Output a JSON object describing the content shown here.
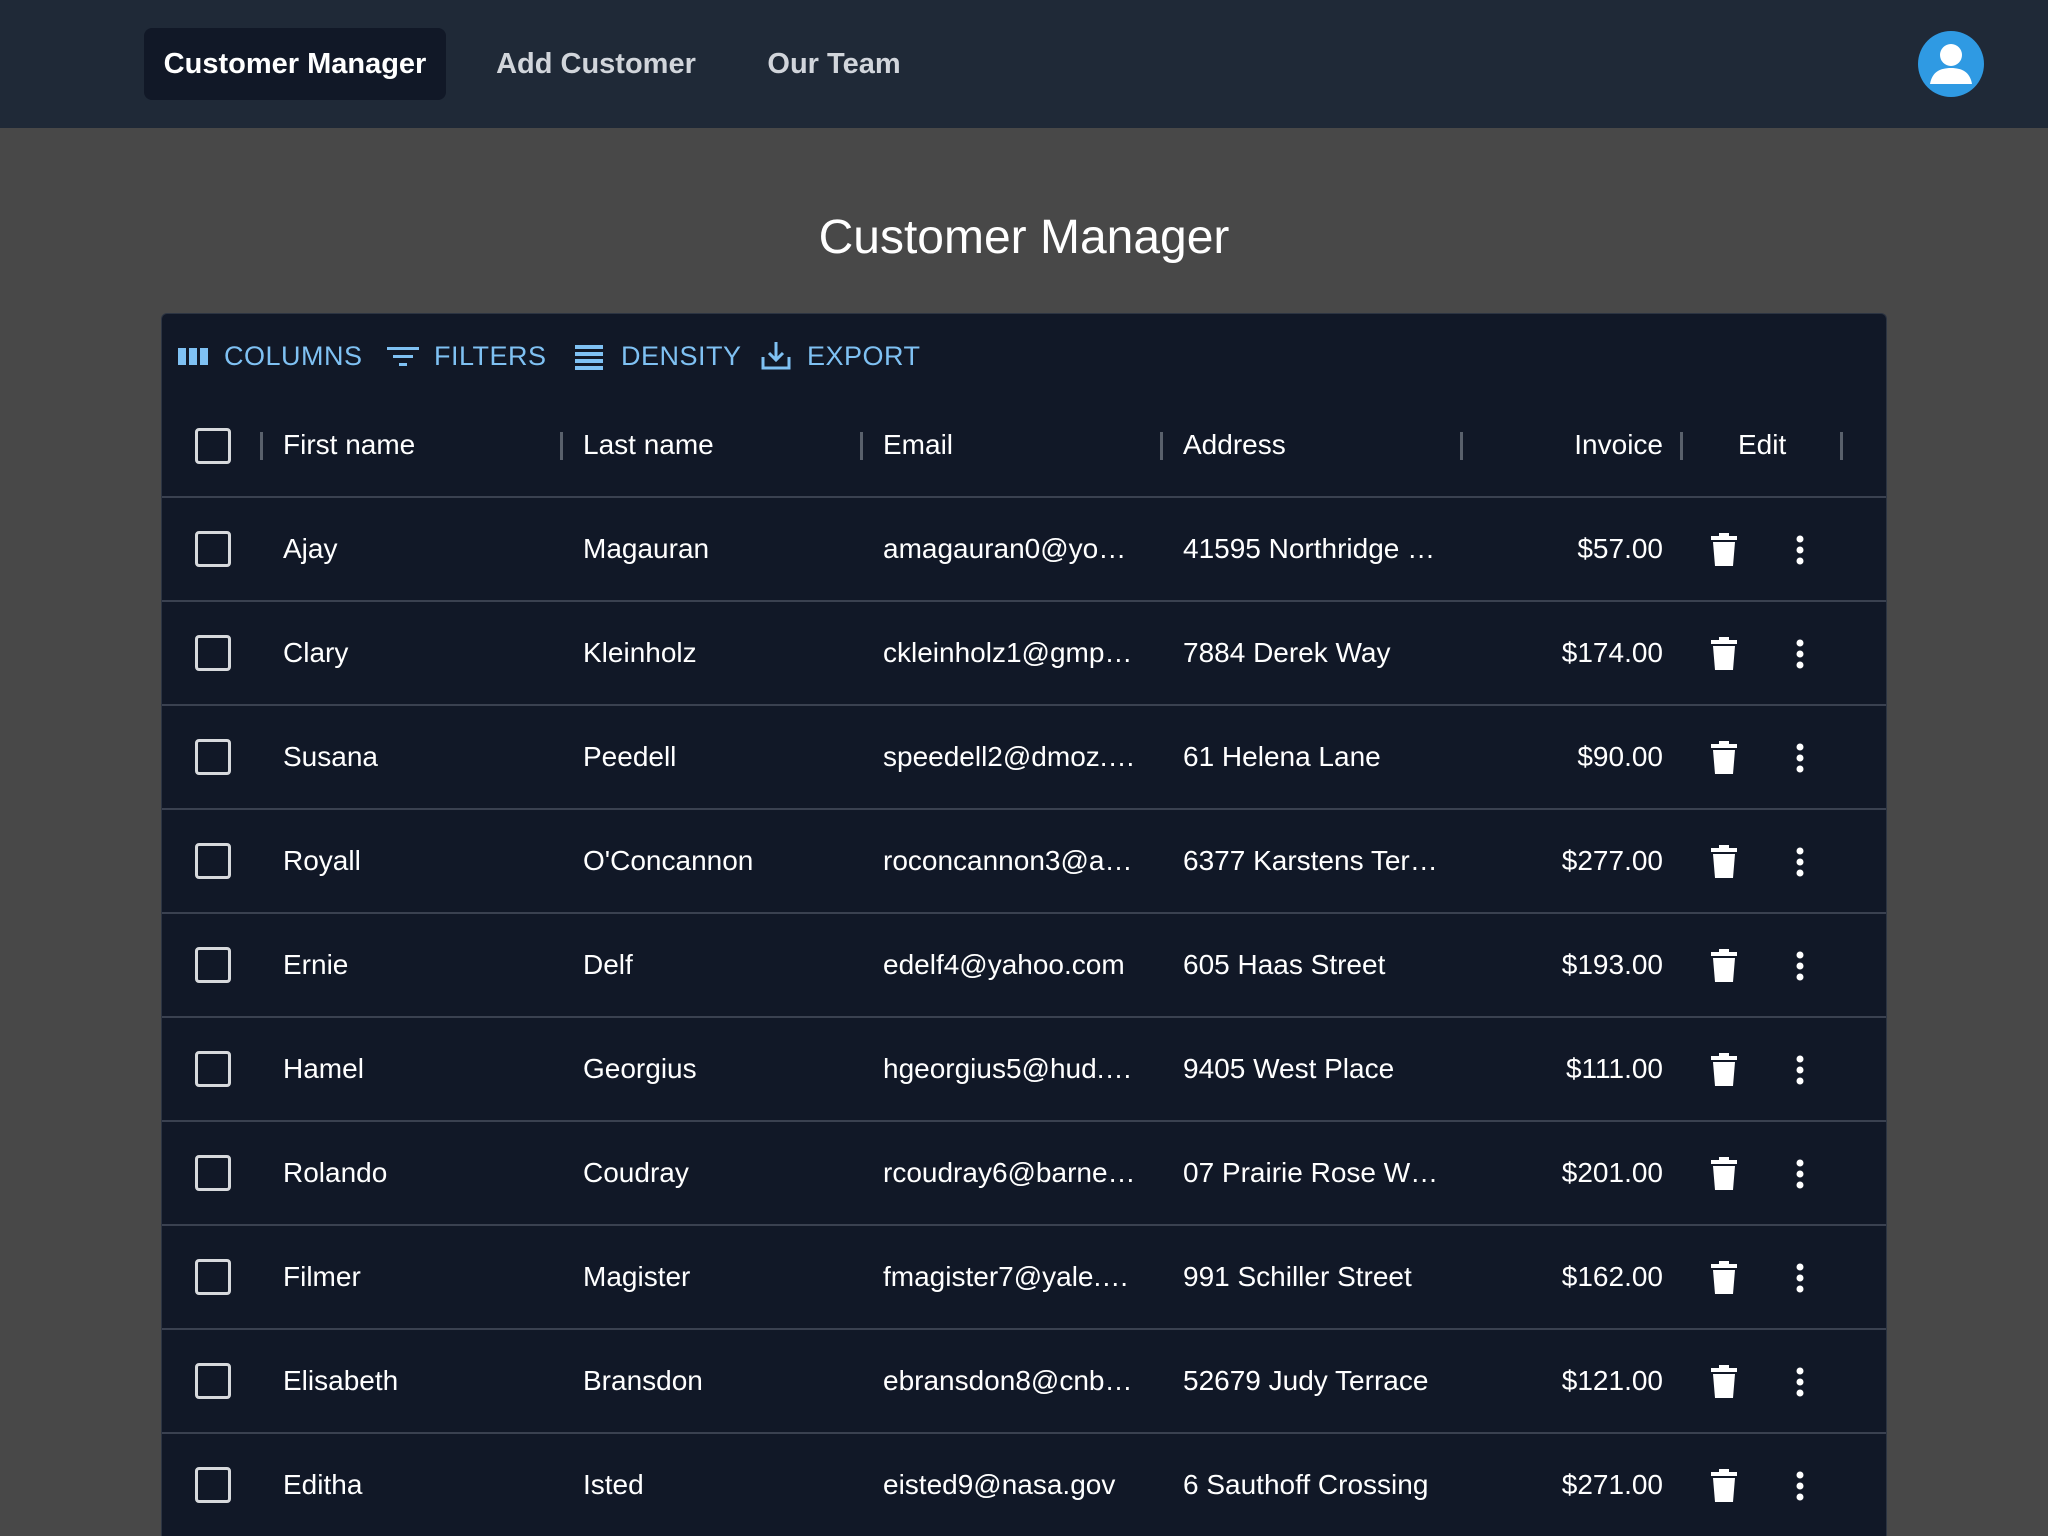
{
  "nav": {
    "tabs": [
      {
        "label": "Customer Manager",
        "active": true
      },
      {
        "label": "Add Customer",
        "active": false
      },
      {
        "label": "Our Team",
        "active": false
      }
    ],
    "avatar_icon": "account-circle-icon"
  },
  "page": {
    "title": "Customer Manager"
  },
  "toolbar": {
    "columns": "COLUMNS",
    "filters": "FILTERS",
    "density": "DENSITY",
    "export": "EXPORT"
  },
  "grid": {
    "headers": {
      "first_name": "First name",
      "last_name": "Last name",
      "email": "Email",
      "address": "Address",
      "invoice": "Invoice",
      "edit": "Edit"
    },
    "rows": [
      {
        "first": "Ajay",
        "last": "Magauran",
        "email": "amagauran0@yo…",
        "address": "41595 Northridge …",
        "invoice": "$57.00"
      },
      {
        "first": "Clary",
        "last": "Kleinholz",
        "email": "ckleinholz1@gmp…",
        "address": "7884 Derek Way",
        "invoice": "$174.00"
      },
      {
        "first": "Susana",
        "last": "Peedell",
        "email": "speedell2@dmoz.…",
        "address": "61 Helena Lane",
        "invoice": "$90.00"
      },
      {
        "first": "Royall",
        "last": "O'Concannon",
        "email": "roconcannon3@a…",
        "address": "6377 Karstens Ter…",
        "invoice": "$277.00"
      },
      {
        "first": "Ernie",
        "last": "Delf",
        "email": "edelf4@yahoo.com",
        "address": "605 Haas Street",
        "invoice": "$193.00"
      },
      {
        "first": "Hamel",
        "last": "Georgius",
        "email": "hgeorgius5@hud.…",
        "address": "9405 West Place",
        "invoice": "$111.00"
      },
      {
        "first": "Rolando",
        "last": "Coudray",
        "email": "rcoudray6@barne…",
        "address": "07 Prairie Rose W…",
        "invoice": "$201.00"
      },
      {
        "first": "Filmer",
        "last": "Magister",
        "email": "fmagister7@yale.…",
        "address": "991 Schiller Street",
        "invoice": "$162.00"
      },
      {
        "first": "Elisabeth",
        "last": "Bransdon",
        "email": "ebransdon8@cnb…",
        "address": "52679 Judy Terrace",
        "invoice": "$121.00"
      },
      {
        "first": "Editha",
        "last": "Isted",
        "email": "eisted9@nasa.gov",
        "address": "6 Sauthoff Crossing",
        "invoice": "$271.00"
      }
    ]
  },
  "colors": {
    "nav_bg": "#1f2937",
    "page_bg": "#484848",
    "grid_bg": "#111827",
    "toolbar_accent": "#7fc1f3",
    "avatar": "#2f9ae3"
  }
}
